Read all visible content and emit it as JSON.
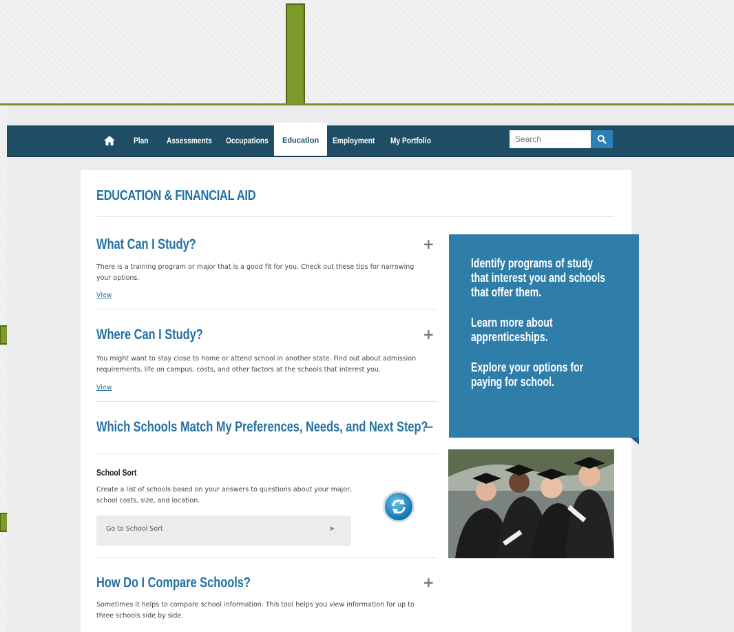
{
  "nav": {
    "items": [
      {
        "label": "Plan"
      },
      {
        "label": "Assessments"
      },
      {
        "label": "Occupations"
      },
      {
        "label": "Education"
      },
      {
        "label": "Employment"
      },
      {
        "label": "My Portfolio"
      }
    ],
    "active": "Education",
    "search_placeholder": "Search"
  },
  "page": {
    "title": "EDUCATION & FINANCIAL AID"
  },
  "sections": [
    {
      "title": "What Can I Study?",
      "text": "There is a training program or major that is a good fit for you. Check out these tips for narrowing your options.",
      "link": "View",
      "toggle": "+"
    },
    {
      "title": "Where Can I Study?",
      "text": "You might want to stay close to home or attend school in another state. Find out about admission requirements, life on campus, costs, and other factors at the schools that interest you.",
      "link": "View",
      "toggle": "+"
    },
    {
      "title": "Which Schools Match My Preferences, Needs, and Next Step?",
      "toggle": "−",
      "sub_title": "School Sort",
      "text": "Create a list of schools based on your answers to questions about your major, school costs, size, and location.",
      "button": "Go to School Sort"
    },
    {
      "title": "How Do I Compare Schools?",
      "text": "Sometimes it helps to compare school information. This tool helps you view information for up to three schools side by side.",
      "toggle": "+"
    }
  ],
  "panel": {
    "lines": [
      "Identify programs of study",
      "that interest you and schools",
      "that offer them.",
      "Learn more about",
      "apprenticeships.",
      "Explore your options for",
      "paying for school."
    ]
  },
  "colors": {
    "navbar": "#1f4d66",
    "accent_blue": "#2370a3",
    "panel": "#2f7eaa",
    "arrow_green": "#7d8f2e"
  }
}
